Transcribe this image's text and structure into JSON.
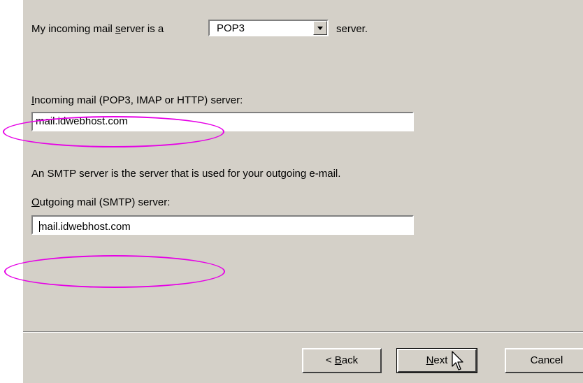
{
  "server_type": {
    "label_prefix": "My incoming mail ",
    "label_underlined": "s",
    "label_rest": "erver is a",
    "selected": "POP3",
    "label_suffix": "server."
  },
  "incoming": {
    "label_underlined": "I",
    "label_rest": "ncoming mail (POP3, IMAP or HTTP) server:",
    "value": "mail.idwebhost.com"
  },
  "smtp_note": "An SMTP server is the server that is used for your outgoing e-mail.",
  "outgoing": {
    "label_underlined": "O",
    "label_rest": "utgoing mail (SMTP) server:",
    "value": "mail.idwebhost.com"
  },
  "buttons": {
    "back_prefix": "< ",
    "back_underlined": "B",
    "back_rest": "ack",
    "next_underlined": "N",
    "next_rest": "ext",
    "cancel": "Cancel"
  },
  "colors": {
    "dialog_bg": "#d4d0c8",
    "annotation": "#e600e6"
  },
  "icons": {
    "cursor": "arrow-cursor-icon",
    "dropdown": "chevron-down-icon"
  }
}
